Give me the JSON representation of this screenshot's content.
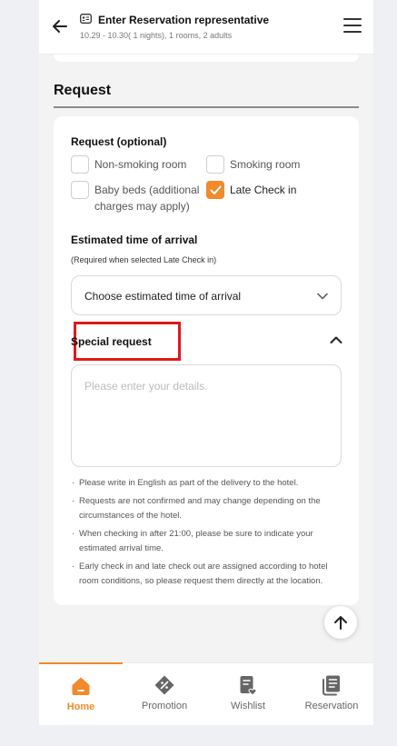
{
  "header": {
    "title": "Enter Reservation representative",
    "subtitle": "10.29 - 10.30( 1 nights), 1 rooms, 2 adults"
  },
  "section": {
    "title": "Request"
  },
  "request": {
    "label": "Request (optional)",
    "options": [
      {
        "label": "Non-smoking room",
        "checked": false
      },
      {
        "label": "Smoking room",
        "checked": false
      },
      {
        "label": "Baby beds (additional charges may apply)",
        "checked": false
      },
      {
        "label": "Late Check in",
        "checked": true
      }
    ]
  },
  "arrival": {
    "label": "Estimated time of arrival",
    "note": "(Required when selected Late Check in)",
    "select_value": "Choose estimated time of arrival"
  },
  "special": {
    "label": "Special request",
    "placeholder": "Please enter your details."
  },
  "notes": [
    "Please write in English as part of the delivery to the hotel.",
    "Requests are not confirmed and may change depending on the circumstances of the hotel.",
    "When checking in after 21:00, please be sure to indicate your estimated arrival time.",
    "Early check in and late check out are assigned according to hotel room conditions, so please request them directly at the location."
  ],
  "tabs": [
    {
      "label": "Home",
      "icon": "home-icon",
      "active": true
    },
    {
      "label": "Promotion",
      "icon": "promotion-icon",
      "active": false
    },
    {
      "label": "Wishlist",
      "icon": "wishlist-icon",
      "active": false
    },
    {
      "label": "Reservation",
      "icon": "reservation-icon",
      "active": false
    }
  ],
  "colors": {
    "accent": "#f08a2b",
    "highlight": "#e01818"
  }
}
